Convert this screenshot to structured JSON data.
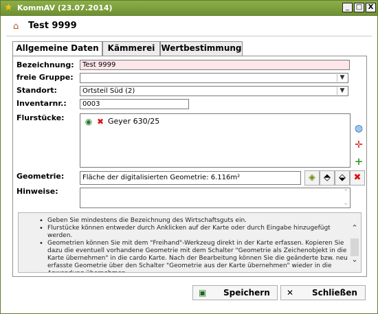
{
  "window": {
    "title": "KommAV (23.07.2014)",
    "buttons": [
      "_",
      "□",
      "X"
    ]
  },
  "header": {
    "title": "Test 9999"
  },
  "tabs": [
    "Allgemeine Daten",
    "Kämmerei",
    "Wertbestimmung"
  ],
  "form": {
    "bezeichnung_label": "Bezeichnung:",
    "bezeichnung_value": "Test 9999",
    "gruppe_label": "freie Gruppe:",
    "gruppe_value": "",
    "standort_label": "Standort:",
    "standort_value": "Ortsteil Süd (2)",
    "inventar_label": "Inventarnr.:",
    "inventar_value": "0003",
    "flurstuecke_label": "Flurstücke:",
    "flurstuecke_items": [
      "Geyer 630/25"
    ],
    "geometrie_label": "Geometrie:",
    "geometrie_value": "Fläche der digitalisierten Geometrie: 6.116m²",
    "hinweise_label": "Hinweise:",
    "hinweise_value": ""
  },
  "info": [
    "Geben Sie mindestens die Bezeichnung des Wirtschaftsguts ein.",
    "Flurstücke können entweder durch Anklicken auf der Karte oder durch Eingabe hinzugefügt werden.",
    "Geometrien können Sie mit dem \"Freihand\"-Werkzeug direkt in der Karte erfassen. Kopieren Sie dazu die eventuell vorhandene Geometrie mit dem Schalter \"Geometrie als Zeichenobjekt in die Karte übernehmen\" in die cardo Karte. Nach der Bearbeitung können Sie die geänderte bzw. neu erfasste Geometrie über den Schalter \"Geometrie aus der Karte übernehmen\" wieder in die Anwendung übernehmen."
  ],
  "buttons": {
    "save": "Speichern",
    "close": "Schließen"
  }
}
